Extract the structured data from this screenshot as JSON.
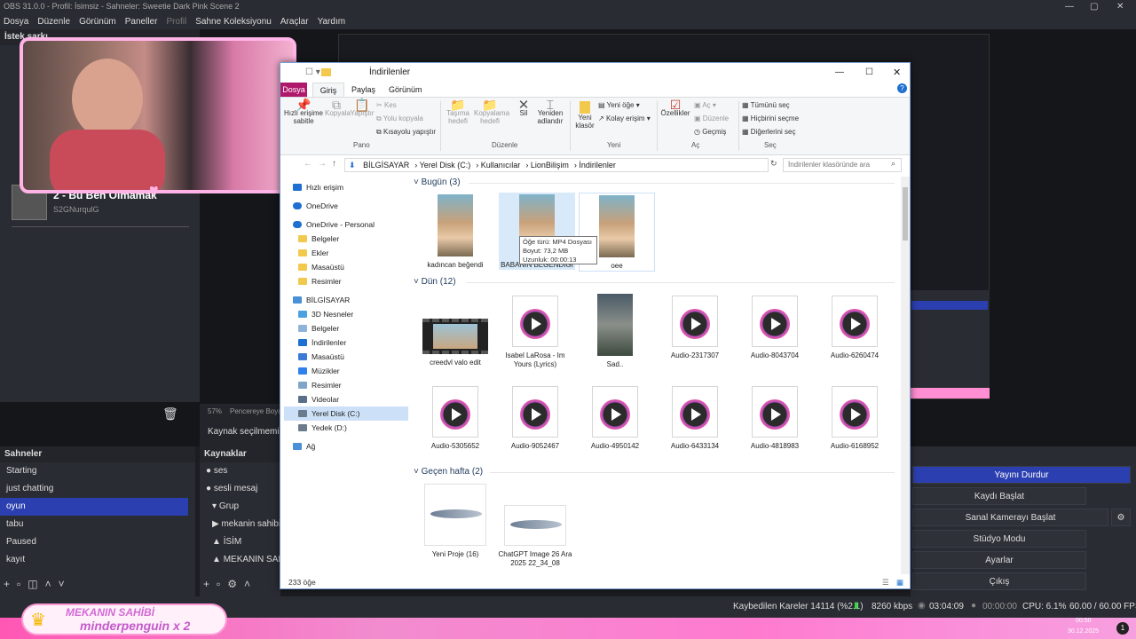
{
  "obs": {
    "title": "OBS 31.0.0 - Profil: İsimsiz - Sahneler: Sweetie Dark Pink Scene 2",
    "menu": [
      "Dosya",
      "Düzenle",
      "Görünüm",
      "Paneller",
      "Profil",
      "Sahne Koleksiyonu",
      "Araçlar",
      "Yardım"
    ],
    "dock_top_title": "İstek şarkı",
    "song_title": "2 - Bu Ben Olmamak",
    "song_artist": "S2GNurqulG",
    "zoom": "57%",
    "zoom_label": "Pencereye Boyut",
    "no_source": "Kaynak seçilmemiş",
    "scenes_title": "Sahneler",
    "scenes": [
      "Starting",
      "just chatting",
      "oyun",
      "tabu",
      "Paused",
      "kayıt"
    ],
    "selected_scene": "oyun",
    "sources_title": "Kaynaklar",
    "sources": [
      "ses",
      "sesli mesaj",
      "Grup",
      "mekanin sahibi",
      "İSİM",
      "MEKANIN SAHİBİ"
    ],
    "controls": [
      "Yayını Durdur",
      "Kaydı Başlat",
      "Sanal Kamerayı Başlat",
      "Stüdyo Modu",
      "Ayarlar",
      "Çıkış"
    ],
    "status": {
      "dropped": "Kaybedilen Kareler 14114 (%2.1)",
      "bitrate": "8260 kbps",
      "live_time": "03:04:09",
      "rec_time": "00:00:00",
      "cpu": "CPU: 6.1%",
      "fps": "60.00 / 60.00 FPS"
    },
    "banner_line1": "MEKANIN SAHİBİ",
    "banner_line2": "minderpenguin x 2",
    "clock": "00:50",
    "date": "30.12.2025"
  },
  "explorer": {
    "title": "İndirilenler",
    "tabs": [
      "Dosya",
      "Giriş",
      "Paylaş",
      "Görünüm"
    ],
    "ribbon": {
      "pin": "Hızlı erişime sabitle",
      "copy": "Kopyala",
      "paste": "Yapıştır",
      "cut": "Kes",
      "copy_path": "Yolu kopyala",
      "paste_shortcut": "Kısayolu yapıştır",
      "move_to": "Taşıma hedefi",
      "copy_to": "Kopyalama hedefi",
      "delete": "Sil",
      "rename": "Yeniden adlandır",
      "new_folder": "Yeni klasör",
      "new_item": "Yeni öğe",
      "easy_access": "Kolay erişim",
      "properties": "Özellikler",
      "open": "Aç",
      "edit": "Düzenle",
      "history": "Geçmiş",
      "select_all": "Tümünü seç",
      "select_none": "Hiçbirini seçme",
      "invert": "Diğerlerini seç",
      "group_clipboard": "Pano",
      "group_organize": "Düzenle",
      "group_new": "Yeni",
      "group_open": "Aç",
      "group_select": "Seç"
    },
    "breadcrumb": [
      "BİLGİSAYAR",
      "Yerel Disk (C:)",
      "Kullanıcılar",
      "LionBilişim",
      "İndirilenler"
    ],
    "search_placeholder": "İndirilenler klasöründe ara",
    "nav": [
      "Hızlı erişim",
      "OneDrive",
      "OneDrive - Personal",
      "Belgeler",
      "Ekler",
      "Masaüstü",
      "Resimler",
      "BİLGİSAYAR",
      "3D Nesneler",
      "Belgeler",
      "İndirilenler",
      "Masaüstü",
      "Müzikler",
      "Resimler",
      "Videolar",
      "Yerel Disk (C:)",
      "Yedek (D:)",
      "Ağ"
    ],
    "groups": {
      "today": "Bugün (3)",
      "yesterday": "Dün (12)",
      "lastweek": "Geçen hafta (2)"
    },
    "today_files": [
      "kadıncan beğendi",
      "BABANIN BEĞENDİĞİ",
      "oee"
    ],
    "yesterday_files": [
      "creedvl valo edit",
      "Isabel LaRosa - Im Yours (Lyrics)",
      "Sad..",
      "Audio-2317307",
      "Audio-8043704",
      "Audio-6260474",
      "Audio-5305652",
      "Audio-9052467",
      "Audio-4950142",
      "Audio-6433134",
      "Audio-4818983",
      "Audio-6168952"
    ],
    "lastweek_files": [
      "Yeni Proje (16)",
      "ChatGPT Image 26 Ara 2025 22_34_08"
    ],
    "tooltip": [
      "Öğe türü: MP4 Dosyası",
      "Boyut: 73,2 MB",
      "Uzunluk: 00:00:13"
    ],
    "item_count": "233 öğe"
  }
}
